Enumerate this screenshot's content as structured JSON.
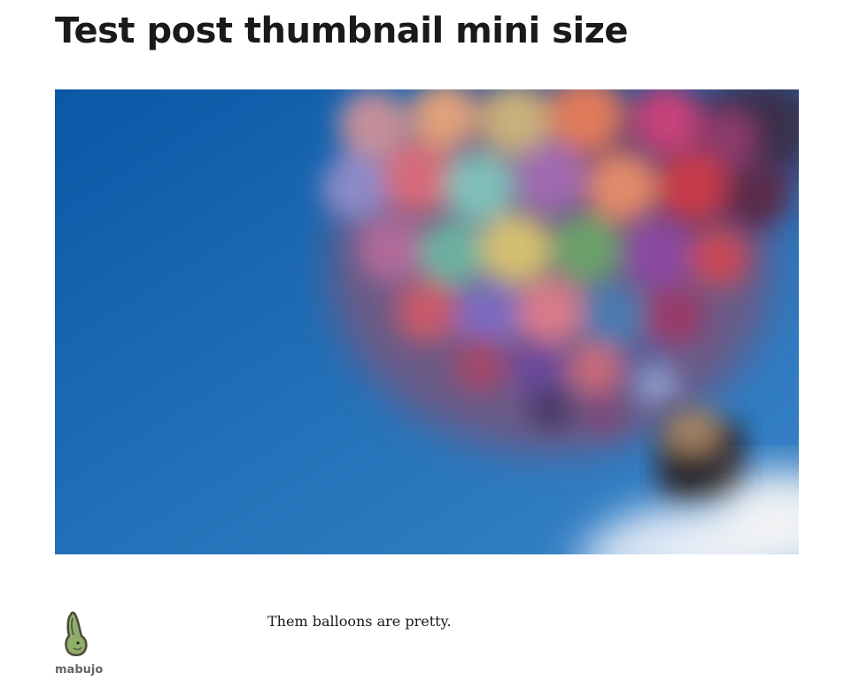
{
  "post": {
    "title": "Test post thumbnail mini size",
    "featured_image": {
      "icon": "hot-air-balloon-photo",
      "sky_color": "#1e6fb8"
    },
    "author": {
      "name": "mabujo",
      "avatar_icon": "rabbit-avatar-icon"
    },
    "content": "Them balloons are pretty."
  }
}
